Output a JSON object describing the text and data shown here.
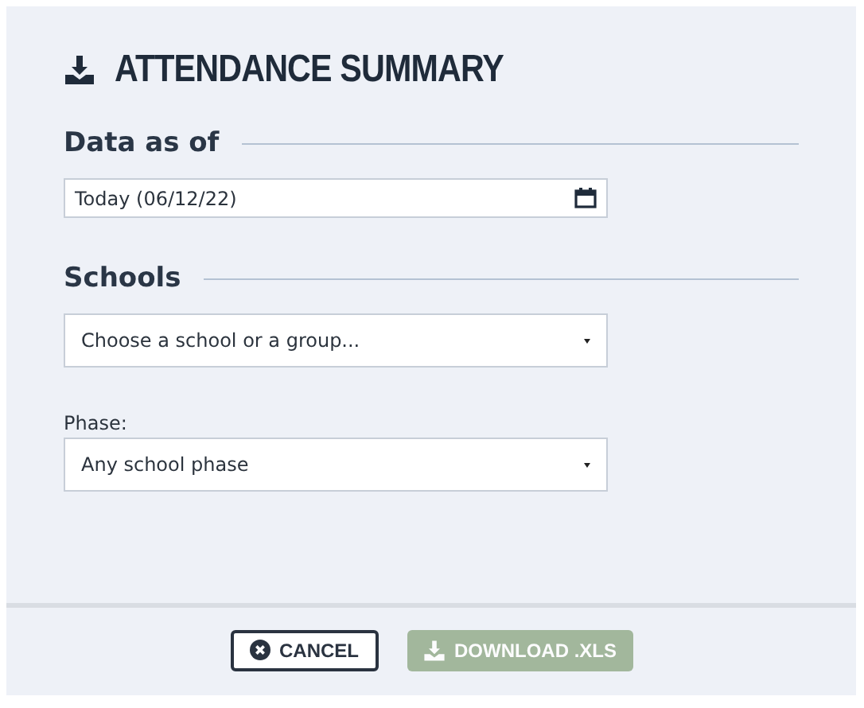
{
  "title": "ATTENDANCE SUMMARY",
  "sections": [
    {
      "heading": "Data as of",
      "fields": [
        {
          "kind": "date",
          "value": "Today (06/12/22)"
        }
      ]
    },
    {
      "heading": "Schools",
      "fields": [
        {
          "kind": "select",
          "placeholder": "Choose a school or a group..."
        },
        {
          "kind": "select",
          "label": "Phase:",
          "value": "Any school phase"
        }
      ]
    }
  ],
  "buttons": [
    {
      "kind": "cancel",
      "label": "CANCEL",
      "disabled": false
    },
    {
      "kind": "download",
      "label": "DOWNLOAD .XLS",
      "disabled": true
    }
  ]
}
